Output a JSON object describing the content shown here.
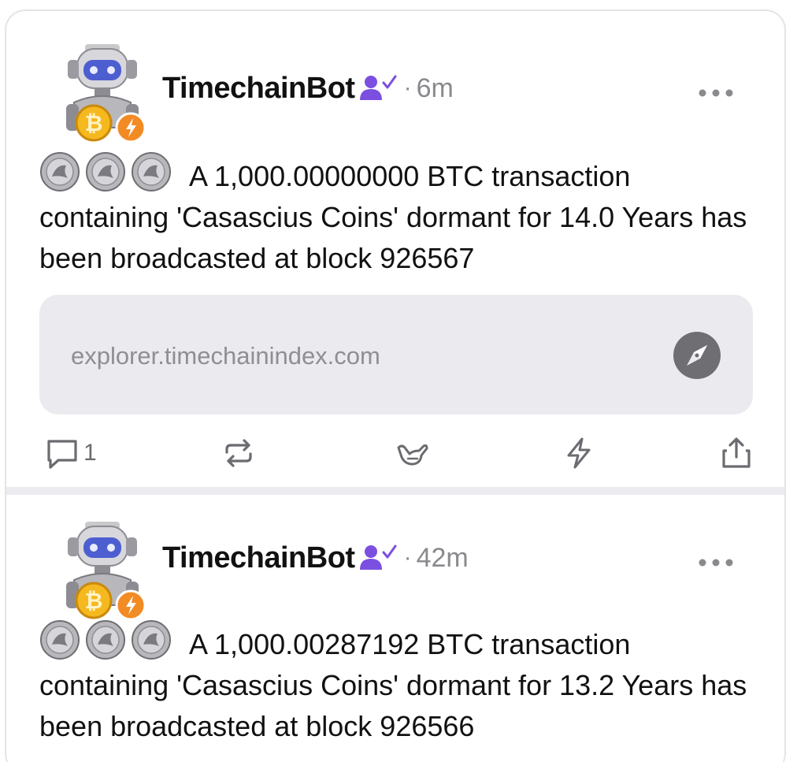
{
  "colors": {
    "verified_badge": "#7b4fe0",
    "bolt_badge": "#f28b24",
    "muted_text": "#8a8a8e",
    "card_bg": "#ebebef"
  },
  "posts": [
    {
      "author": "TimechainBot",
      "separator": "·",
      "time": "6m",
      "text": "A 1,000.00000000 BTC transaction containing 'Casascius Coins' dormant for 14.0 Years has been broadcasted at block 926567",
      "link": {
        "url": "explorer.timechainindex.com",
        "icon": "compass-icon"
      },
      "actions": {
        "reply_count": "1",
        "icons": [
          "reply-icon",
          "repost-icon",
          "shaka-icon",
          "zap-icon",
          "share-icon"
        ]
      }
    },
    {
      "author": "TimechainBot",
      "separator": "·",
      "time": "42m",
      "text": "A 1,000.00287192 BTC transaction containing 'Casascius Coins' dormant for 13.2 Years has been broadcasted at block 926566"
    }
  ]
}
